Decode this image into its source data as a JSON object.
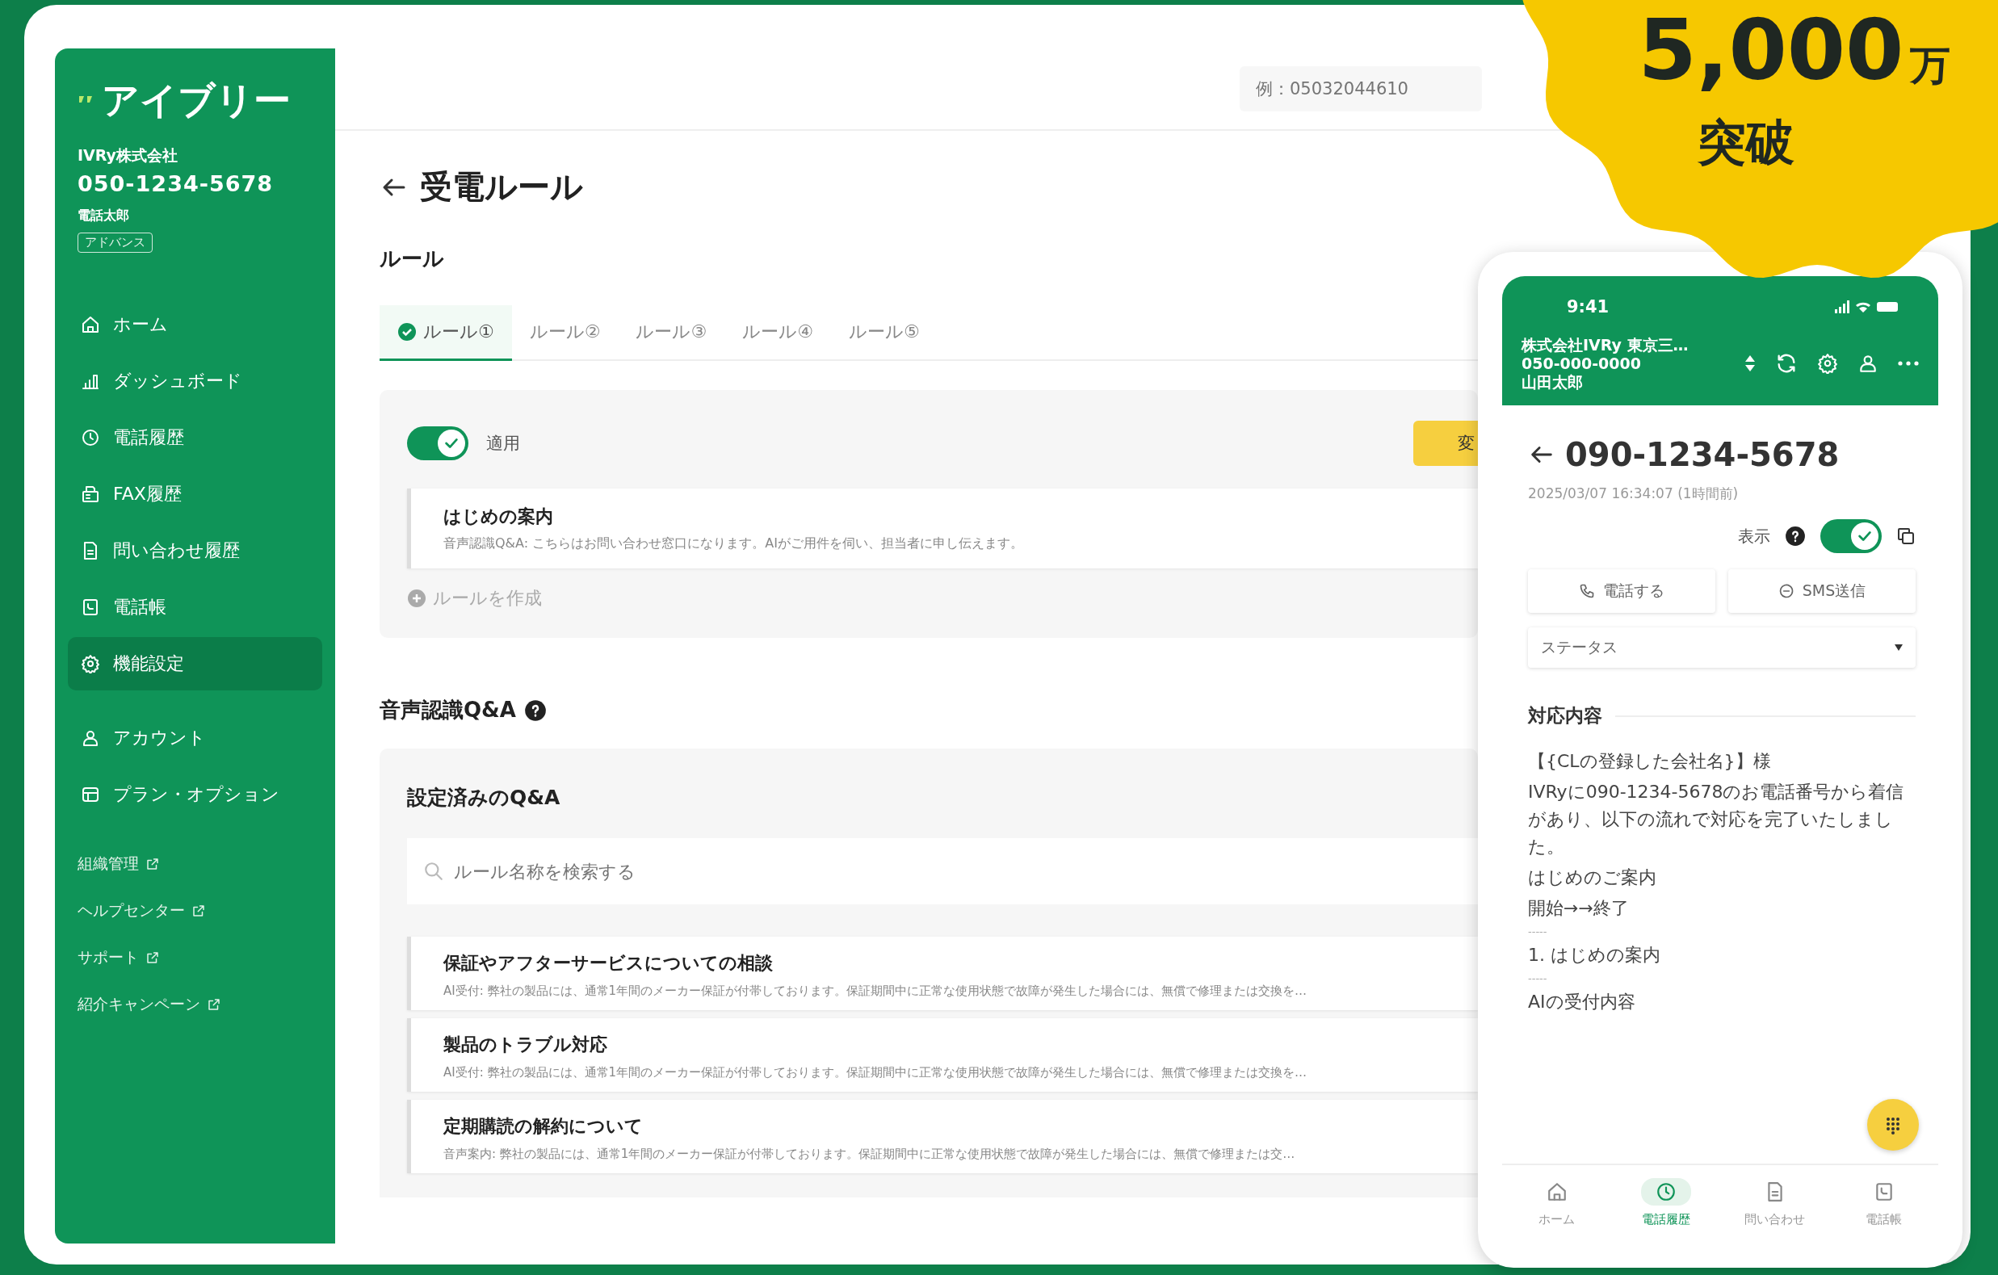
{
  "badge": {
    "number": "5,000",
    "unit": "万",
    "caption": "突破"
  },
  "sidebar": {
    "logo": "アイブリー",
    "company": "IVRy株式会社",
    "phone": "050-1234-5678",
    "user": "電話太郎",
    "plan": "アドバンス",
    "items": [
      {
        "label": "ホーム",
        "selected": false
      },
      {
        "label": "ダッシュボード",
        "selected": false
      },
      {
        "label": "電話履歴",
        "selected": false
      },
      {
        "label": "FAX履歴",
        "selected": false
      },
      {
        "label": "問い合わせ履歴",
        "selected": false
      },
      {
        "label": "電話帳",
        "selected": false
      },
      {
        "label": "機能設定",
        "selected": true
      },
      {
        "label": "アカウント",
        "selected": false
      },
      {
        "label": "プラン・オプション",
        "selected": false
      }
    ],
    "links": [
      {
        "label": "組織管理"
      },
      {
        "label": "ヘルプセンター"
      },
      {
        "label": "サポート"
      },
      {
        "label": "紹介キャンペーン"
      }
    ]
  },
  "topbar": {
    "search_placeholder": "例：05032044610"
  },
  "page": {
    "title": "受電ルール",
    "section": "ルール",
    "tabs": [
      {
        "label": "ルール①",
        "selected": true
      },
      {
        "label": "ルール②",
        "selected": false
      },
      {
        "label": "ルール③",
        "selected": false
      },
      {
        "label": "ルール④",
        "selected": false
      },
      {
        "label": "ルール⑤",
        "selected": false
      }
    ],
    "rule": {
      "enabled": true,
      "toggle_label": "適用",
      "button": "変",
      "item": {
        "title": "はじめの案内",
        "description": "音声認識Q&A: こちらはお問い合わせ窓口になります。AIがご用件を伺い、担当者に申し伝えます。"
      },
      "create": "ルールを作成"
    }
  },
  "qa": {
    "title": "音声認識Q&A",
    "panel_title": "設定済みのQ&A",
    "search_placeholder": "ルール名称を検索する",
    "items": [
      {
        "title": "保証やアフターサービスについての相談",
        "description": "AI受付: 弊社の製品には、通常1年間のメーカー保証が付帯しております。保証期間中に正常な使用状態で故障が発生した場合には、無償で修理または交換を…"
      },
      {
        "title": "製品のトラブル対応",
        "description": "AI受付: 弊社の製品には、通常1年間のメーカー保証が付帯しております。保証期間中に正常な使用状態で故障が発生した場合には、無償で修理または交換を…"
      },
      {
        "title": "定期購読の解約について",
        "description": "音声案内: 弊社の製品には、通常1年間のメーカー保証が付帯しております。保証期間中に正常な使用状態で故障が発生した場合には、無償で修理または交…"
      }
    ]
  },
  "phone": {
    "time": "9:41",
    "org": "株式会社IVRy 東京三…",
    "number": "050-000-0000",
    "user": "山田太郎",
    "caller": "090-1234-5678",
    "datetime": "2025/03/07 16:34:07 (1時間前)",
    "display_label": "表示",
    "display_on": true,
    "call_button": "電話する",
    "sms_button": "SMS送信",
    "status_select": "ステータス",
    "content_title": "対応内容",
    "content_lines": [
      "【{CLの登録した会社名}】様",
      "IVRyに090-1234-5678のお電話番号から着信があり、以下の流れで対応を完了いたしました。",
      "はじめのご案内",
      "開始→→終了",
      "-----",
      "1. はじめの案内",
      "-----",
      "AIの受付内容"
    ],
    "nav": [
      {
        "label": "ホーム",
        "selected": false
      },
      {
        "label": "電話履歴",
        "selected": true
      },
      {
        "label": "問い合わせ",
        "selected": false
      },
      {
        "label": "電話帳",
        "selected": false
      }
    ]
  }
}
